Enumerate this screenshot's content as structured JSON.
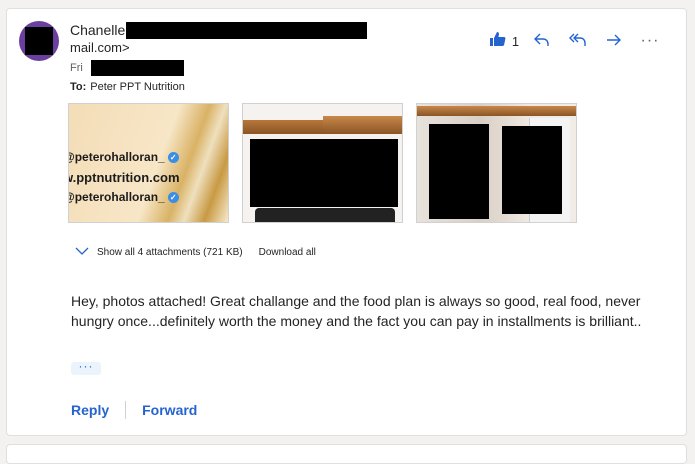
{
  "message": {
    "sender_name": "Chanelle",
    "sender_email": "mail.com>",
    "date_prefix": "Fri",
    "to_label": "To:",
    "to_value": "Peter PPT Nutrition",
    "like_count": "1",
    "body": "Hey, photos attached! Great challange and the food plan is always so good, real food, never hungry once...definitely worth the money and the fact you can pay in installments is brilliant..",
    "ellipsis": "···"
  },
  "actions": {
    "like_icon": "thumbs-up-icon",
    "reply_icon": "reply-icon",
    "reply_all_icon": "reply-all-icon",
    "forward_icon": "forward-icon",
    "more_icon": "more-icon",
    "more_label": "···"
  },
  "attachments": {
    "promo_lines": [
      "@peterohalloran_",
      "w.pptnutrition.com",
      "@peterohalloran_"
    ],
    "show_all_label": "Show all 4 attachments (721 KB)",
    "download_all_label": "Download all"
  },
  "footer": {
    "reply_label": "Reply",
    "forward_label": "Forward"
  },
  "colors": {
    "accent": "#2564cf",
    "avatar": "#6b3fa0"
  }
}
